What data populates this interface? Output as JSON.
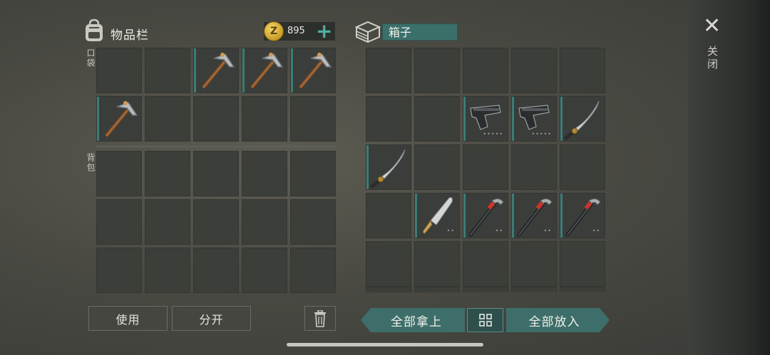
{
  "inventory": {
    "title": "物品栏",
    "pocket_label": "口袋",
    "backpack_label": "背包",
    "coins": "895",
    "coin_symbol": "Z",
    "add_symbol": "+"
  },
  "pocket_items": [
    "",
    "",
    "pickaxe",
    "pickaxe",
    "pickaxe",
    "pickaxe",
    "",
    "",
    "",
    ""
  ],
  "box": {
    "name": "箱子",
    "items": [
      "",
      "",
      "",
      "",
      "",
      "",
      "",
      "pistol",
      "pistol",
      "katana",
      "katana",
      "",
      "",
      "",
      "",
      "",
      "machete",
      "crowbar",
      "crowbar",
      "crowbar",
      "",
      "",
      "",
      "",
      ""
    ]
  },
  "actions": {
    "use": "使用",
    "split": "分开",
    "take_all": "全部拿上",
    "put_all": "全部放入",
    "close": "关闭"
  },
  "icons": {
    "backpack": "backpack-icon",
    "trash": "trash-icon",
    "box": "box-icon",
    "sort": "sort-grid-icon",
    "close": "close-icon"
  },
  "colors": {
    "accent": "#3d6e69",
    "slot": "#3c3e3a",
    "coin": "#e0b43c"
  }
}
